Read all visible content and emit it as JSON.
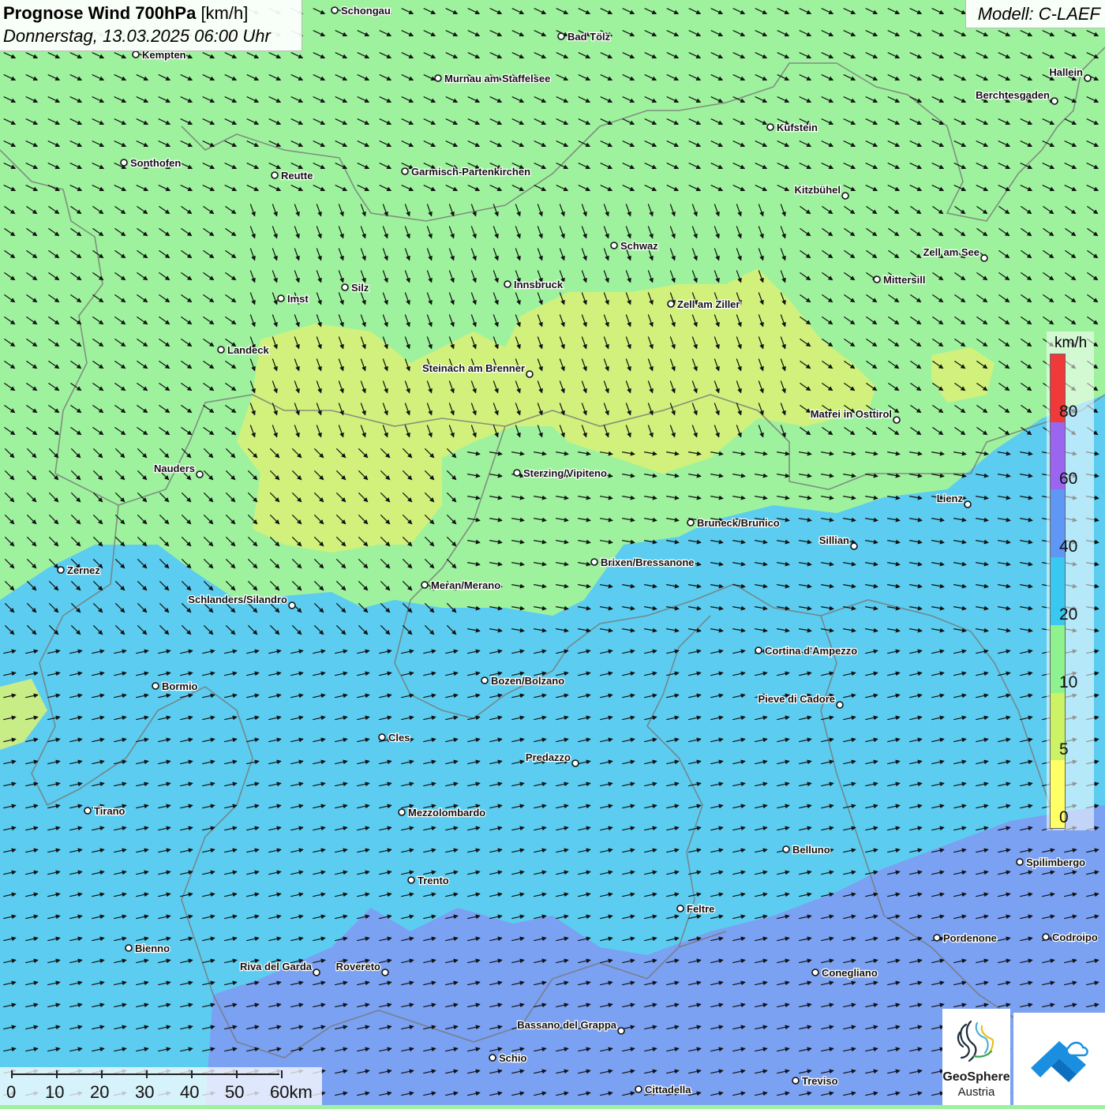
{
  "header": {
    "title_bold": "Prognose Wind 700hPa",
    "title_unit": "[km/h]",
    "date": "Donnerstag, 13.03.2025 06:00 Uhr"
  },
  "model": "Modell: C-LAEF",
  "legend": {
    "unit": "km/h",
    "steps": [
      {
        "label": "0",
        "color": "#ffff66"
      },
      {
        "label": "5",
        "color": "#ccf266"
      },
      {
        "label": "10",
        "color": "#8ef28e"
      },
      {
        "label": "20",
        "color": "#38c8f0"
      },
      {
        "label": "40",
        "color": "#5f97f5"
      },
      {
        "label": "60",
        "color": "#9a66f0"
      },
      {
        "label": "80",
        "color": "#f03a3a"
      }
    ]
  },
  "scale_bar": {
    "labels": [
      "0",
      "10",
      "20",
      "30",
      "40",
      "50",
      "60km"
    ]
  },
  "logos": {
    "geosphere_line1": "GeoSphere",
    "geosphere_line2": "Austria"
  },
  "cities": [
    {
      "name": "Schongau"
    },
    {
      "name": "Bad Tölz"
    },
    {
      "name": "Kempten"
    },
    {
      "name": "Murnau am Staffelsee"
    },
    {
      "name": "Hallein"
    },
    {
      "name": "Berchtesgaden"
    },
    {
      "name": "Kufstein"
    },
    {
      "name": "Sonthofen"
    },
    {
      "name": "Reutte"
    },
    {
      "name": "Garmisch-Partenkirchen"
    },
    {
      "name": "Kitzbühel"
    },
    {
      "name": "Schwaz"
    },
    {
      "name": "Zell am See"
    },
    {
      "name": "Innsbruck"
    },
    {
      "name": "Mittersill"
    },
    {
      "name": "Silz"
    },
    {
      "name": "Imst"
    },
    {
      "name": "Zell am Ziller"
    },
    {
      "name": "Landeck"
    },
    {
      "name": "Steinach am Brenner"
    },
    {
      "name": "Matrei in Osttirol"
    },
    {
      "name": "Nauders"
    },
    {
      "name": "Sterzing/Vipiteno"
    },
    {
      "name": "Lienz"
    },
    {
      "name": "Bruneck/Brunico"
    },
    {
      "name": "Sillian"
    },
    {
      "name": "Brixen/Bressanone"
    },
    {
      "name": "Zernez"
    },
    {
      "name": "Meran/Merano"
    },
    {
      "name": "Schlanders/Silandro"
    },
    {
      "name": "Cortina d'Ampezzo"
    },
    {
      "name": "Bozen/Bolzano"
    },
    {
      "name": "Bormio"
    },
    {
      "name": "Pieve di Cadore"
    },
    {
      "name": "Cles"
    },
    {
      "name": "Predazzo"
    },
    {
      "name": "Tirano"
    },
    {
      "name": "Mezzolombardo"
    },
    {
      "name": "Belluno"
    },
    {
      "name": "Spilimbergo"
    },
    {
      "name": "Trento"
    },
    {
      "name": "Feltre"
    },
    {
      "name": "Pordenone"
    },
    {
      "name": "Codroipo"
    },
    {
      "name": "Bienno"
    },
    {
      "name": "Riva del Garda"
    },
    {
      "name": "Rovereto"
    },
    {
      "name": "Conegliano"
    },
    {
      "name": "Bassano del Grappa"
    },
    {
      "name": "Schio"
    },
    {
      "name": "Treviso"
    },
    {
      "name": "Cittadella"
    }
  ]
}
